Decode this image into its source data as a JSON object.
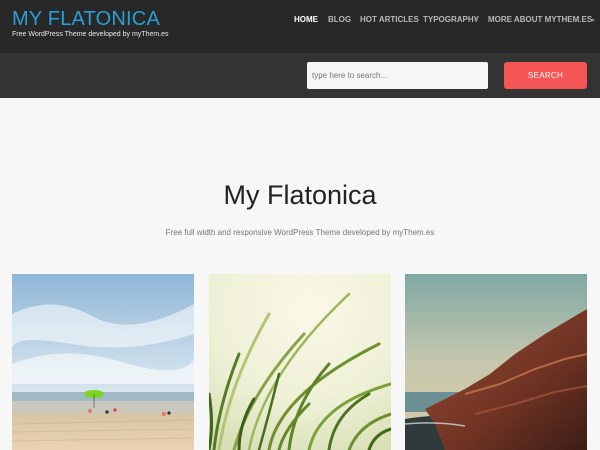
{
  "site": {
    "title": "MY FLATONICA",
    "description": "Free WordPress Theme developed by myThem.es"
  },
  "nav": {
    "items": [
      {
        "label": "HOME",
        "active": true
      },
      {
        "label": "BLOG"
      },
      {
        "label": "HOT ARTICLES"
      },
      {
        "label": "TYPOGRAPHY",
        "has_submenu": true
      },
      {
        "label": "MORE ABOUT MYTHEM.ES",
        "has_submenu": true
      }
    ]
  },
  "search": {
    "placeholder": "type here to search...",
    "button_label": "SEARCH"
  },
  "hero": {
    "title": "My Flatonica",
    "subtitle": "Free full width and responsive WordPress Theme developed by myThem.es"
  },
  "thumbnails": [
    {
      "icon": "beach-photo"
    },
    {
      "icon": "grass-photo"
    },
    {
      "icon": "coastal-cliff-photo"
    }
  ],
  "colors": {
    "header_bg": "#282828",
    "search_band_bg": "#333333",
    "accent_title": "#2a9fd6",
    "search_button": "#f65556",
    "page_bg": "#f7f7f7"
  }
}
